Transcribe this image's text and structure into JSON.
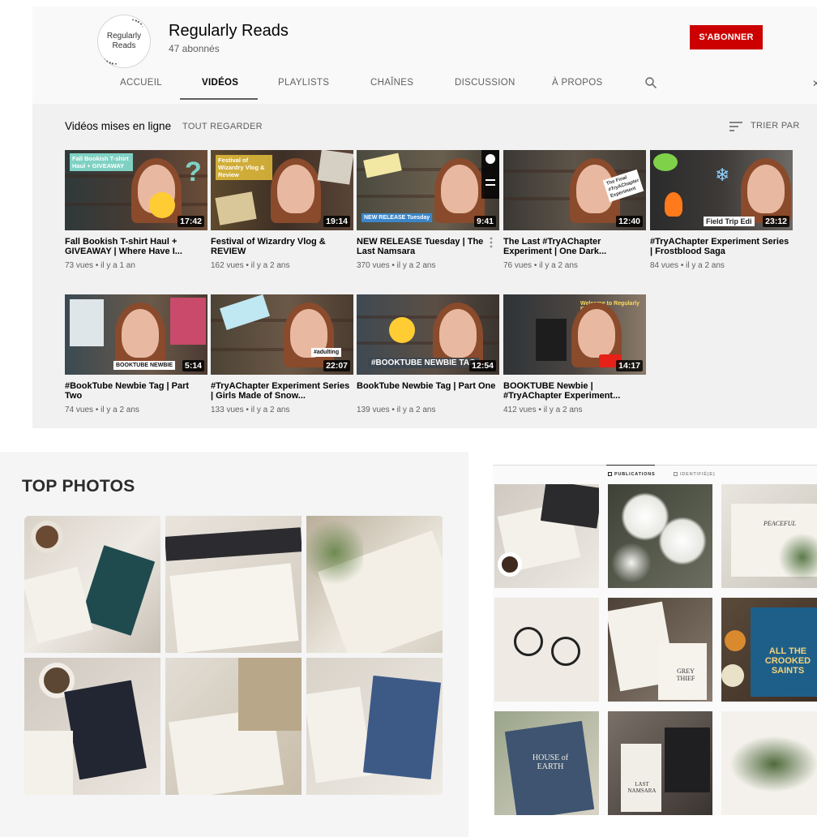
{
  "channel": {
    "avatar_text_line1": "Regularly",
    "avatar_text_line2": "Reads",
    "name": "Regularly Reads",
    "subscribers": "47 abonnés",
    "subscribe_label": "S'ABONNER",
    "subscribe_color": "#cc0000"
  },
  "tabs": [
    {
      "label": "ACCUEIL",
      "active": false
    },
    {
      "label": "VIDÉOS",
      "active": true
    },
    {
      "label": "PLAYLISTS",
      "active": false
    },
    {
      "label": "CHAÎNES",
      "active": false
    },
    {
      "label": "DISCUSSION",
      "active": false
    },
    {
      "label": "À PROPOS",
      "active": false
    }
  ],
  "tab_icons": {
    "search": "search-icon",
    "close": "close-icon"
  },
  "section": {
    "title": "Vidéos mises en ligne",
    "view_all": "TOUT REGARDER",
    "sort_label": "TRIER PAR",
    "sort_icon": "sort-icon"
  },
  "videos": [
    {
      "title": "Fall Bookish T-shirt Haul + GIVEAWAY | Where Have I...",
      "views": "73 vues",
      "age": "il y a 1 an",
      "duration": "17:42",
      "thumb_text": "Fall Bookish T-shirt Haul + GIVEAWAY"
    },
    {
      "title": "Festival of Wizardry Vlog & REVIEW",
      "views": "162 vues",
      "age": "il y a 2 ans",
      "duration": "19:14",
      "thumb_text": "Festival of Wizardry Vlog & Review"
    },
    {
      "title": "NEW RELEASE Tuesday | The Last Namsara",
      "views": "370 vues",
      "age": "il y a 2 ans",
      "duration": "9:41",
      "thumb_text": "NEW RELEASE Tuesday"
    },
    {
      "title": "The Last #TryAChapter Experiment | One Dark...",
      "views": "76 vues",
      "age": "il y a 2 ans",
      "duration": "12:40",
      "thumb_text": "The Final #TryAChapter Experiment"
    },
    {
      "title": "#TryAChapter Experiment Series | Frostblood Saga",
      "views": "84 vues",
      "age": "il y a 2 ans",
      "duration": "23:12",
      "thumb_text": "Field Trip Edi"
    },
    {
      "title": "#BookTube Newbie Tag | Part Two",
      "views": "74 vues",
      "age": "il y a 2 ans",
      "duration": "5:14",
      "thumb_text": "BOOKTUBE NEWBIE"
    },
    {
      "title": "#TryAChapter Experiment Series | Girls Made of Snow...",
      "views": "133 vues",
      "age": "il y a 2 ans",
      "duration": "22:07",
      "thumb_text": "#adulting"
    },
    {
      "title": "BookTube Newbie Tag | Part One",
      "views": "139 vues",
      "age": "il y a 2 ans",
      "duration": "12:54",
      "thumb_text": "#BOOKTUBE NEWBIE TAG"
    },
    {
      "title": "BOOKTUBE Newbie | #TryAChapter Experiment...",
      "views": "412 vues",
      "age": "il y a 2 ans",
      "duration": "14:17",
      "thumb_text": "Welcome to Regularly Reads"
    }
  ],
  "meta_separator": "•",
  "top_photos": {
    "title": "TOP PHOTOS"
  },
  "instagram": {
    "tabs": [
      {
        "label": "PUBLICATIONS",
        "active": true
      },
      {
        "label": "IDENTIFIÉ(E)",
        "active": false
      }
    ],
    "book_titles": [
      "GREY THIEF",
      "ALL THE CROOKED SAINTS",
      "HOUSE of EARTH",
      "LAST NAMSARA",
      "PEACEFUL"
    ]
  }
}
